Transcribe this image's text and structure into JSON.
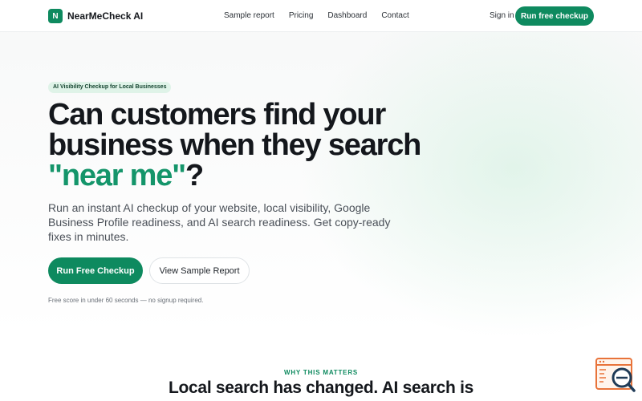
{
  "header": {
    "logo_letter": "N",
    "brand_name": "NearMeCheck AI",
    "nav": [
      {
        "label": "Sample report"
      },
      {
        "label": "Pricing"
      },
      {
        "label": "Dashboard"
      },
      {
        "label": "Contact"
      }
    ],
    "signin_label": "Sign in",
    "cta_label": "Run free checkup"
  },
  "hero": {
    "badge": "AI Visibility Checkup for Local Businesses",
    "headline_before": "Can customers find your business when they search ",
    "headline_accent": "\"near me\"",
    "headline_after": "?",
    "lede": "Run an instant AI checkup of your website, local visibility, Google Business Profile readiness, and AI search readiness. Get copy-ready fixes in minutes.",
    "primary_cta": "Run Free Checkup",
    "secondary_cta": "View Sample Report",
    "fineprint": "Free score in under 60 seconds — no signup required."
  },
  "section": {
    "eyebrow": "WHY THIS MATTERS",
    "heading": "Local search has changed. AI search is"
  },
  "widget": {
    "icon": "search-report-icon"
  },
  "colors": {
    "brand_green": "#0e8a5f",
    "accent_green": "#14956a",
    "widget_orange": "#e8733a",
    "widget_blue": "#1f3b57"
  }
}
